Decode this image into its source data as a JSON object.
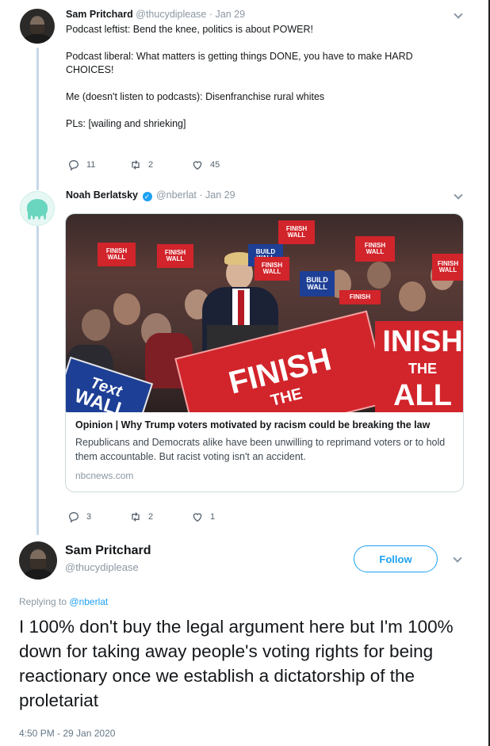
{
  "tweets": [
    {
      "name": "Sam Pritchard",
      "handle": "@thucydiplease",
      "separator": "·",
      "date": "Jan 29",
      "paragraphs": [
        "Podcast leftist: Bend the knee, politics is about POWER!",
        "Podcast liberal: What matters is getting things DONE, you have to make HARD\nCHOICES!",
        "Me (doesn't listen to podcasts): Disenfranchise rural whites",
        "PLs: [wailing and shrieking]"
      ],
      "replies": "11",
      "retweets": "2",
      "likes": "45"
    },
    {
      "name": "Noah Berlatsky",
      "handle": "@nberlat",
      "separator": "·",
      "date": "Jan 29",
      "verified": true,
      "card": {
        "title": "Opinion | Why Trump voters motivated by racism could be breaking the law",
        "description": "Republicans and Democrats alike have been unwilling to reprimand voters or to hold them accountable. But racist voting isn't an accident.",
        "domain": "nbcnews.com",
        "signs": {
          "finish": "FINISH",
          "the": "THE",
          "wall": "WALL",
          "build": "BUILD",
          "big_finish": "FINISH",
          "big_the": "THE",
          "right_inish": "INISH",
          "right_the": "THE",
          "right_wall": "ALL",
          "text": "Text",
          "text_wall": "WALL"
        }
      },
      "replies": "3",
      "retweets": "2",
      "likes": "1"
    }
  ],
  "main_tweet": {
    "name": "Sam Pritchard",
    "handle": "@thucydiplease",
    "follow_label": "Follow",
    "replying_prefix": "Replying to",
    "replying_to": "@nberlat",
    "text": "I 100% don't buy the legal argument here but I'm 100% down for taking away people's voting rights for being reactionary once we establish a dictatorship of the proletariat",
    "timestamp": "4:50 PM - 29 Jan 2020"
  },
  "colors": {
    "accent": "#1da1f2",
    "thread_line": "#c6d8e6",
    "muted": "#8a97a3",
    "sign_red": "#d2242b",
    "sign_blue": "#1d3f95"
  }
}
